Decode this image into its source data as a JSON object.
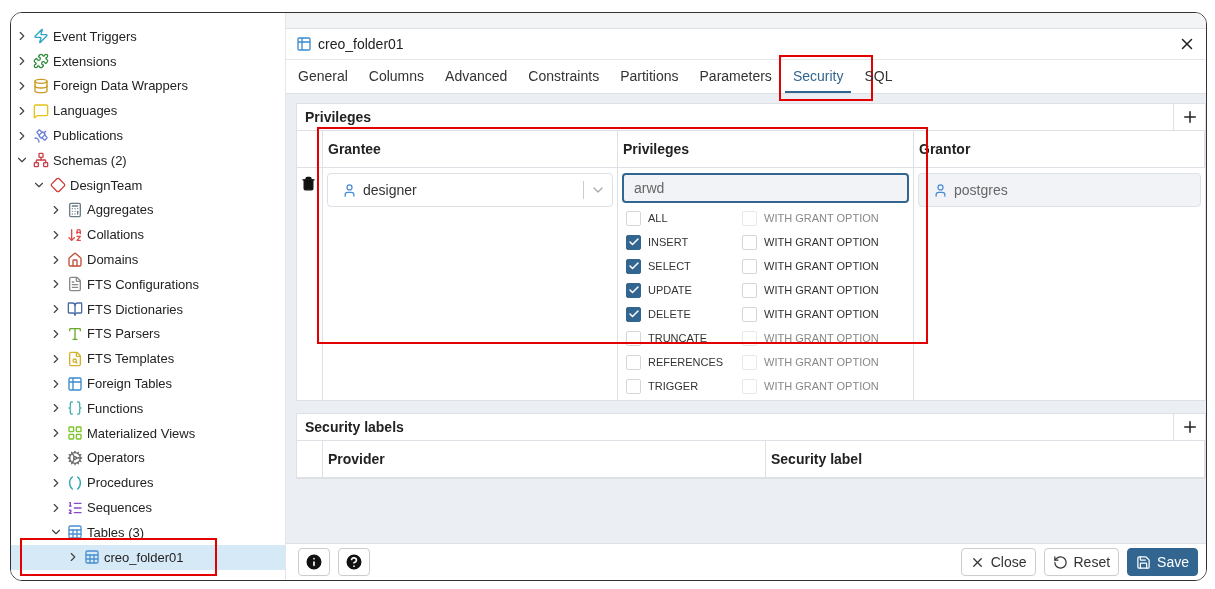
{
  "tree": [
    {
      "label": "Event Triggers",
      "expanded": false,
      "selected": false
    },
    {
      "label": "Extensions",
      "expanded": false,
      "selected": false
    },
    {
      "label": "Foreign Data Wrappers",
      "expanded": false,
      "selected": false
    },
    {
      "label": "Languages",
      "expanded": false,
      "selected": false
    },
    {
      "label": "Publications",
      "expanded": false,
      "selected": false
    },
    {
      "label": "Schemas (2)",
      "expanded": true,
      "selected": false,
      "children": [
        {
          "label": "DesignTeam",
          "expanded": true,
          "selected": false,
          "children": [
            {
              "label": "Aggregates",
              "expanded": false,
              "selected": false
            },
            {
              "label": "Collations",
              "expanded": false,
              "selected": false
            },
            {
              "label": "Domains",
              "expanded": false,
              "selected": false
            },
            {
              "label": "FTS Configurations",
              "expanded": false,
              "selected": false
            },
            {
              "label": "FTS Dictionaries",
              "expanded": false,
              "selected": false
            },
            {
              "label": "FTS Parsers",
              "expanded": false,
              "selected": false
            },
            {
              "label": "FTS Templates",
              "expanded": false,
              "selected": false
            },
            {
              "label": "Foreign Tables",
              "expanded": false,
              "selected": false
            },
            {
              "label": "Functions",
              "expanded": false,
              "selected": false
            },
            {
              "label": "Materialized Views",
              "expanded": false,
              "selected": false
            },
            {
              "label": "Operators",
              "expanded": false,
              "selected": false
            },
            {
              "label": "Procedures",
              "expanded": false,
              "selected": false
            },
            {
              "label": "Sequences",
              "expanded": false,
              "selected": false
            },
            {
              "label": "Tables (3)",
              "expanded": true,
              "selected": false,
              "children": [
                {
                  "label": "creo_folder01",
                  "expanded": false,
                  "selected": true,
                  "highlighted": true
                }
              ]
            }
          ]
        }
      ]
    }
  ],
  "dialog": {
    "title": "creo_folder01",
    "tabs": [
      {
        "label": "General",
        "selected": false
      },
      {
        "label": "Columns",
        "selected": false
      },
      {
        "label": "Advanced",
        "selected": false
      },
      {
        "label": "Constraints",
        "selected": false
      },
      {
        "label": "Partitions",
        "selected": false
      },
      {
        "label": "Parameters",
        "selected": false
      },
      {
        "label": "Security",
        "selected": true,
        "highlighted": true
      },
      {
        "label": "SQL",
        "selected": false
      }
    ],
    "privileges": {
      "title": "Privileges",
      "columns": [
        "Grantee",
        "Privileges",
        "Grantor"
      ],
      "highlighted": true,
      "row": {
        "grantee": "designer",
        "value": "arwd",
        "grantor": "postgres",
        "options": [
          {
            "label": "ALL",
            "checked": false,
            "grant_label": "WITH GRANT OPTION",
            "grant_checked": false,
            "grant_disabled": true
          },
          {
            "label": "INSERT",
            "checked": true,
            "grant_label": "WITH GRANT OPTION",
            "grant_checked": false,
            "grant_disabled": false
          },
          {
            "label": "SELECT",
            "checked": true,
            "grant_label": "WITH GRANT OPTION",
            "grant_checked": false,
            "grant_disabled": false
          },
          {
            "label": "UPDATE",
            "checked": true,
            "grant_label": "WITH GRANT OPTION",
            "grant_checked": false,
            "grant_disabled": false
          },
          {
            "label": "DELETE",
            "checked": true,
            "grant_label": "WITH GRANT OPTION",
            "grant_checked": false,
            "grant_disabled": false
          },
          {
            "label": "TRUNCATE",
            "checked": false,
            "grant_label": "WITH GRANT OPTION",
            "grant_checked": false,
            "grant_disabled": true
          },
          {
            "label": "REFERENCES",
            "checked": false,
            "grant_label": "WITH GRANT OPTION",
            "grant_checked": false,
            "grant_disabled": true
          },
          {
            "label": "TRIGGER",
            "checked": false,
            "grant_label": "WITH GRANT OPTION",
            "grant_checked": false,
            "grant_disabled": true
          }
        ]
      }
    },
    "security_labels": {
      "title": "Security labels",
      "columns": [
        "Provider",
        "Security label"
      ]
    },
    "footer_buttons": [
      {
        "label": "Close",
        "kind": "close"
      },
      {
        "label": "Reset",
        "kind": "reset"
      },
      {
        "label": "Save",
        "kind": "save"
      }
    ]
  }
}
